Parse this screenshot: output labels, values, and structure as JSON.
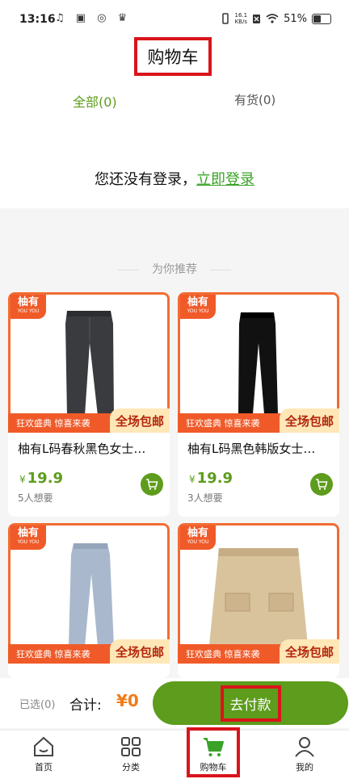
{
  "status_bar": {
    "time": "13:16",
    "left_icons": "♫ ▣ ◎ ♛",
    "net_speed_value": "16.1",
    "net_speed_unit": "KB/s",
    "battery": "51%"
  },
  "header": {
    "title": "购物车",
    "tabs": [
      {
        "label": "全部(0)"
      },
      {
        "label": "有货(0)"
      }
    ],
    "login_prompt": "您还没有登录，",
    "login_link": "立即登录"
  },
  "recommend": {
    "title": "为你推荐"
  },
  "products": [
    {
      "brand": "柚有",
      "brand_sub": "YOU YOU",
      "promo_left": "狂欢盛典 惊喜来袭",
      "promo_right": "全场包邮",
      "name": "柚有L码春秋黑色女士…",
      "currency": "¥",
      "price": "19.9",
      "wants": "5人想要",
      "image": "dark-grey-jeans"
    },
    {
      "brand": "柚有",
      "brand_sub": "YOU YOU",
      "promo_left": "狂欢盛典 惊喜来袭",
      "promo_right": "全场包邮",
      "name": "柚有L码黑色韩版女士…",
      "currency": "¥",
      "price": "19.9",
      "wants": "3人想要",
      "image": "black-trousers"
    },
    {
      "brand": "柚有",
      "brand_sub": "YOU YOU",
      "promo_left": "狂欢盛典 惊喜来袭",
      "promo_right": "全场包邮",
      "name": "",
      "image": "light-blue-jeans"
    },
    {
      "brand": "柚有",
      "brand_sub": "YOU YOU",
      "promo_left": "狂欢盛典 惊喜来袭",
      "promo_right": "全场包邮",
      "name": "",
      "image": "tweed-skirt"
    }
  ],
  "bottom_bar": {
    "selected": "已选(0)",
    "total_label": "合计:",
    "total_value": "¥0",
    "pay_button": "去付款"
  },
  "tabbar": [
    {
      "label": "首页",
      "icon": "home-icon"
    },
    {
      "label": "分类",
      "icon": "category-grid-icon"
    },
    {
      "label": "购物车",
      "icon": "cart-icon"
    },
    {
      "label": "我的",
      "icon": "profile-icon"
    }
  ],
  "colors": {
    "accent": "#5d9c1c",
    "promo": "#f05a28",
    "price_total": "#f07c18",
    "highlight_box": "#d9141b"
  }
}
